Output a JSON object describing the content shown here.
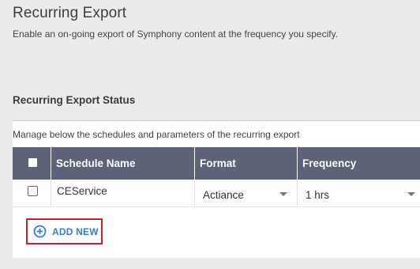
{
  "header": {
    "title": "Recurring Export",
    "subtitle": "Enable an on-going export of Symphony content at the frequency you specify."
  },
  "status_section": {
    "title": "Recurring Export Status",
    "description": "Manage below the schedules and parameters of the recurring export"
  },
  "table": {
    "columns": [
      "Schedule Name",
      "Format",
      "Frequency"
    ],
    "rows": [
      {
        "checked": false,
        "schedule_name": "CEService",
        "format": "Actiance",
        "frequency": "1 hrs"
      }
    ]
  },
  "actions": {
    "add_new_label": "ADD NEW",
    "add_new_icon": "plus-circle-icon"
  },
  "colors": {
    "header_bg": "#5c6278",
    "link": "#2f7fd1",
    "highlight_border": "#cc1f2e",
    "page_bg": "#ebebeb"
  }
}
